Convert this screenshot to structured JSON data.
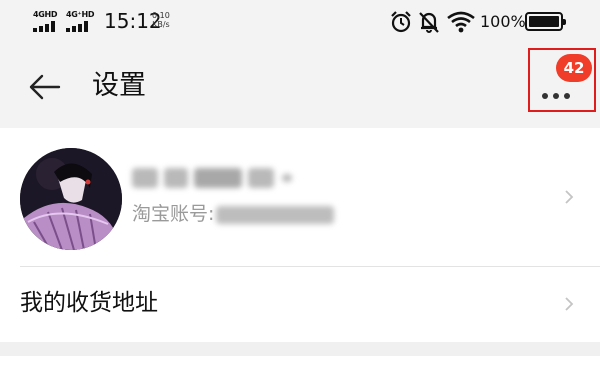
{
  "status_bar": {
    "network1": "4GHD",
    "network2": "4G⁺HD",
    "time": "15:12",
    "speed_value": "0.10",
    "speed_unit": "KB/s",
    "battery_text": "100%",
    "battery_level": 1.0,
    "icons": [
      "alarm-icon",
      "bell-muted-icon",
      "wifi-icon",
      "battery-icon"
    ]
  },
  "header": {
    "title": "设置",
    "back_icon": "arrow-left-icon",
    "more_icon": "more-dots-icon",
    "badge_count": "42",
    "highlight_color": "#e01d1d",
    "badge_color": "#ef3d2a"
  },
  "profile": {
    "nickname": "",
    "account_label": "淘宝账号:",
    "account_value": ""
  },
  "menu": {
    "address_label": "我的收货地址"
  }
}
